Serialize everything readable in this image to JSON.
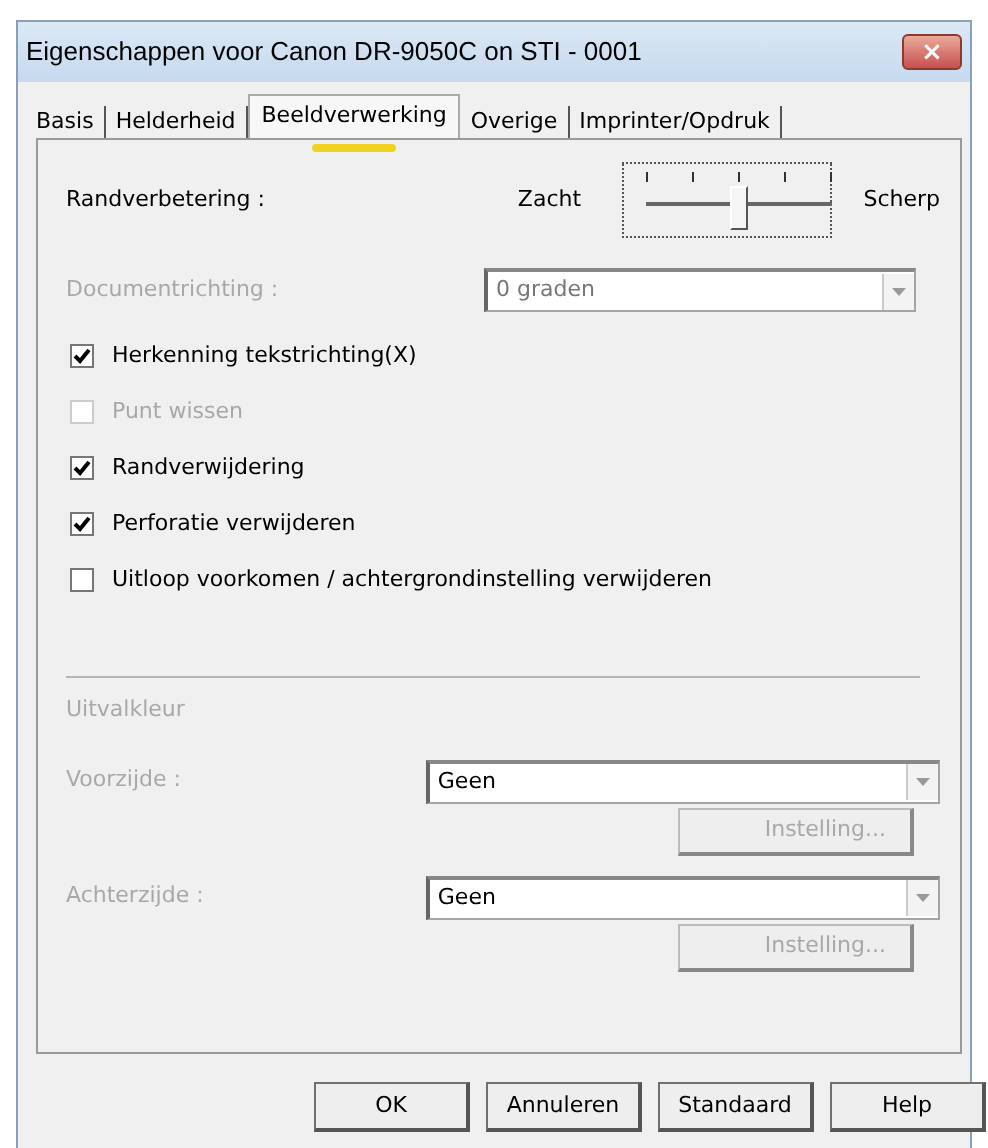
{
  "window": {
    "title": "Eigenschappen voor Canon DR-9050C on STI - 0001",
    "close": "×"
  },
  "tabs": [
    {
      "label": "Basis",
      "selected": false
    },
    {
      "label": "Helderheid",
      "selected": false
    },
    {
      "label": "Beeldverwerking",
      "selected": true
    },
    {
      "label": "Overige",
      "selected": false
    },
    {
      "label": "Imprinter/Opdruk",
      "selected": false
    }
  ],
  "edge_enhancement": {
    "label": "Randverbetering :",
    "min_label": "Zacht",
    "max_label": "Scherp",
    "level": 0.5
  },
  "document_direction": {
    "label": "Documentrichting :",
    "value": "0 graden",
    "disabled": true
  },
  "options": [
    {
      "label": "Herkenning tekstrichting(X)",
      "checked": true,
      "disabled": false
    },
    {
      "label": "Punt wissen",
      "checked": false,
      "disabled": true
    },
    {
      "label": "Randverwijdering",
      "checked": true,
      "disabled": false
    },
    {
      "label": "Perforatie verwijderen",
      "checked": true,
      "disabled": false
    },
    {
      "label": "Uitloop voorkomen / achtergrondinstelling verwijderen",
      "checked": false,
      "disabled": false
    }
  ],
  "dropout_color": {
    "title": "Uitvalkleur",
    "disabled": true,
    "rows": [
      {
        "label": "Voorzijde :",
        "value": "Geen",
        "button": "Instelling..."
      },
      {
        "label": "Achterzijde :",
        "value": "Geen",
        "button": "Instelling..."
      }
    ]
  },
  "buttons": [
    "OK",
    "Annuleren",
    "Standaard",
    "Help"
  ]
}
